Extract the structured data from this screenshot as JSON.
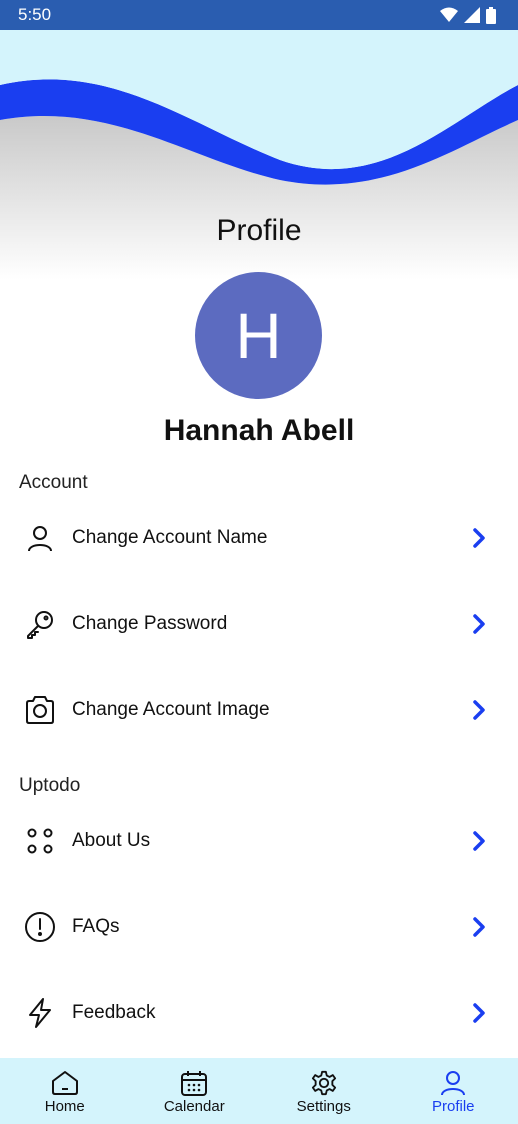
{
  "status_bar": {
    "time": "5:50"
  },
  "header": {
    "title": "Profile"
  },
  "profile": {
    "initial": "H",
    "name": "Hannah Abell"
  },
  "sections": {
    "account": {
      "label": "Account",
      "items": [
        {
          "label": "Change Account Name",
          "icon": "person-icon"
        },
        {
          "label": "Change Password",
          "icon": "key-icon"
        },
        {
          "label": "Change Account Image",
          "icon": "camera-icon"
        }
      ]
    },
    "uptodo": {
      "label": "Uptodo",
      "items": [
        {
          "label": "About Us",
          "icon": "four-dots-icon"
        },
        {
          "label": "FAQs",
          "icon": "info-circle-icon"
        },
        {
          "label": "Feedback",
          "icon": "lightning-icon"
        }
      ]
    }
  },
  "bottom_nav": {
    "items": [
      {
        "label": "Home",
        "icon": "home-icon"
      },
      {
        "label": "Calendar",
        "icon": "calendar-icon"
      },
      {
        "label": "Settings",
        "icon": "gear-icon"
      },
      {
        "label": "Profile",
        "icon": "person-icon"
      }
    ],
    "active": "Profile"
  },
  "colors": {
    "status_bar": "#2a5db0",
    "accent": "#1a3ef0",
    "avatar": "#5c6bc0",
    "header_bg": "#d4f4fc"
  }
}
